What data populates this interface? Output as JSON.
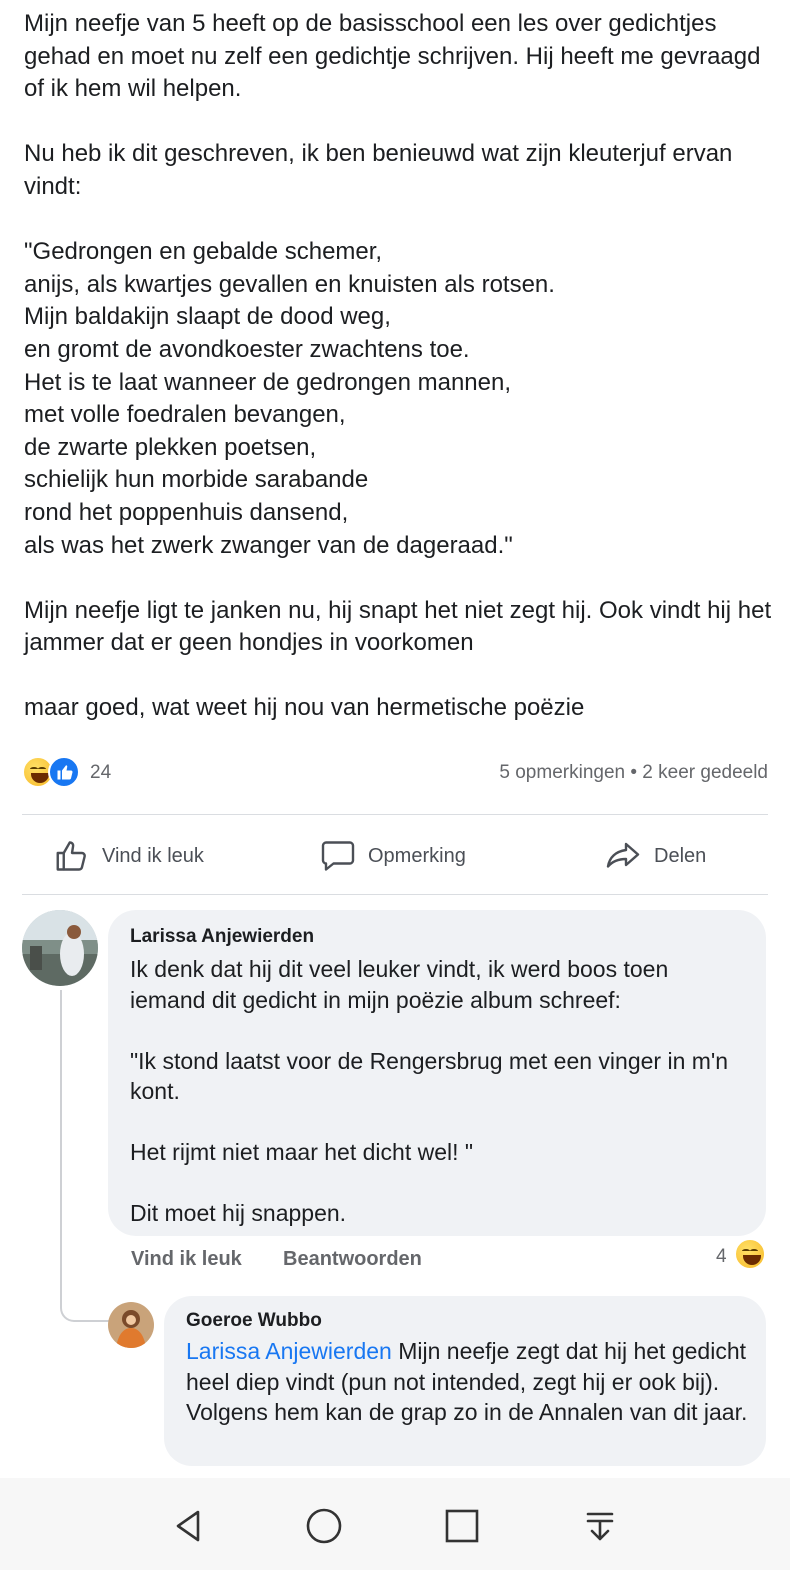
{
  "post": {
    "paragraphs": [
      "Mijn neefje van 5 heeft op de basisschool een les over gedichtjes gehad en moet nu zelf een gedichtje schrijven. Hij heeft me gevraagd of ik hem wil helpen.",
      "Nu heb ik dit geschreven, ik ben benieuwd wat zijn kleuterjuf ervan vindt:",
      "\"Gedrongen en gebalde schemer,\nanijs, als kwartjes gevallen en knuisten als rotsen.\nMijn baldakijn slaapt de dood weg,\nen gromt de avondkoester zwachtens toe.\nHet is te laat wanneer de gedrongen mannen,\nmet volle foedralen bevangen,\nde zwarte plekken poetsen,\nschielijk hun morbide sarabande\nrond het poppenhuis dansend,\nals was het zwerk zwanger van de dageraad.\"",
      "Mijn neefje ligt te janken nu, hij snapt het niet zegt hij. Ook vindt hij het jammer dat er geen hondjes in voorkomen",
      "maar goed, wat weet hij nou van hermetische poëzie"
    ],
    "reaction_count": "24",
    "stats": "5 opmerkingen • 2 keer gedeeld"
  },
  "actions": {
    "like": "Vind ik leuk",
    "comment": "Opmerking",
    "share": "Delen"
  },
  "comments": [
    {
      "author": "Larissa Anjewierden",
      "text": "Ik denk dat hij dit veel leuker vindt, ik werd boos toen iemand dit gedicht in mijn poëzie album schreef:\n\n\"Ik stond laatst voor de Rengersbrug met een vinger in m'n kont.\n\nHet rijmt niet maar het dicht wel! \"\n\nDit moet hij snappen.",
      "like_label": "Vind ik leuk",
      "reply_label": "Beantwoorden",
      "reaction_count": "4"
    },
    {
      "author": "Goeroe Wubbo",
      "mention": "Larissa Anjewierden",
      "text": " Mijn neefje zegt dat hij het gedicht heel diep vindt (pun not intended, zegt hij er ook bij). Volgens hem kan de grap zo in de Annalen van dit jaar."
    }
  ],
  "navigation": [
    "back-icon",
    "home-icon",
    "recents-icon",
    "notification-pulldown-icon"
  ],
  "colors": {
    "accent": "#1877f2",
    "bubble": "#f0f2f5",
    "secondary_text": "#65676b",
    "laugh": "#f7b928"
  }
}
